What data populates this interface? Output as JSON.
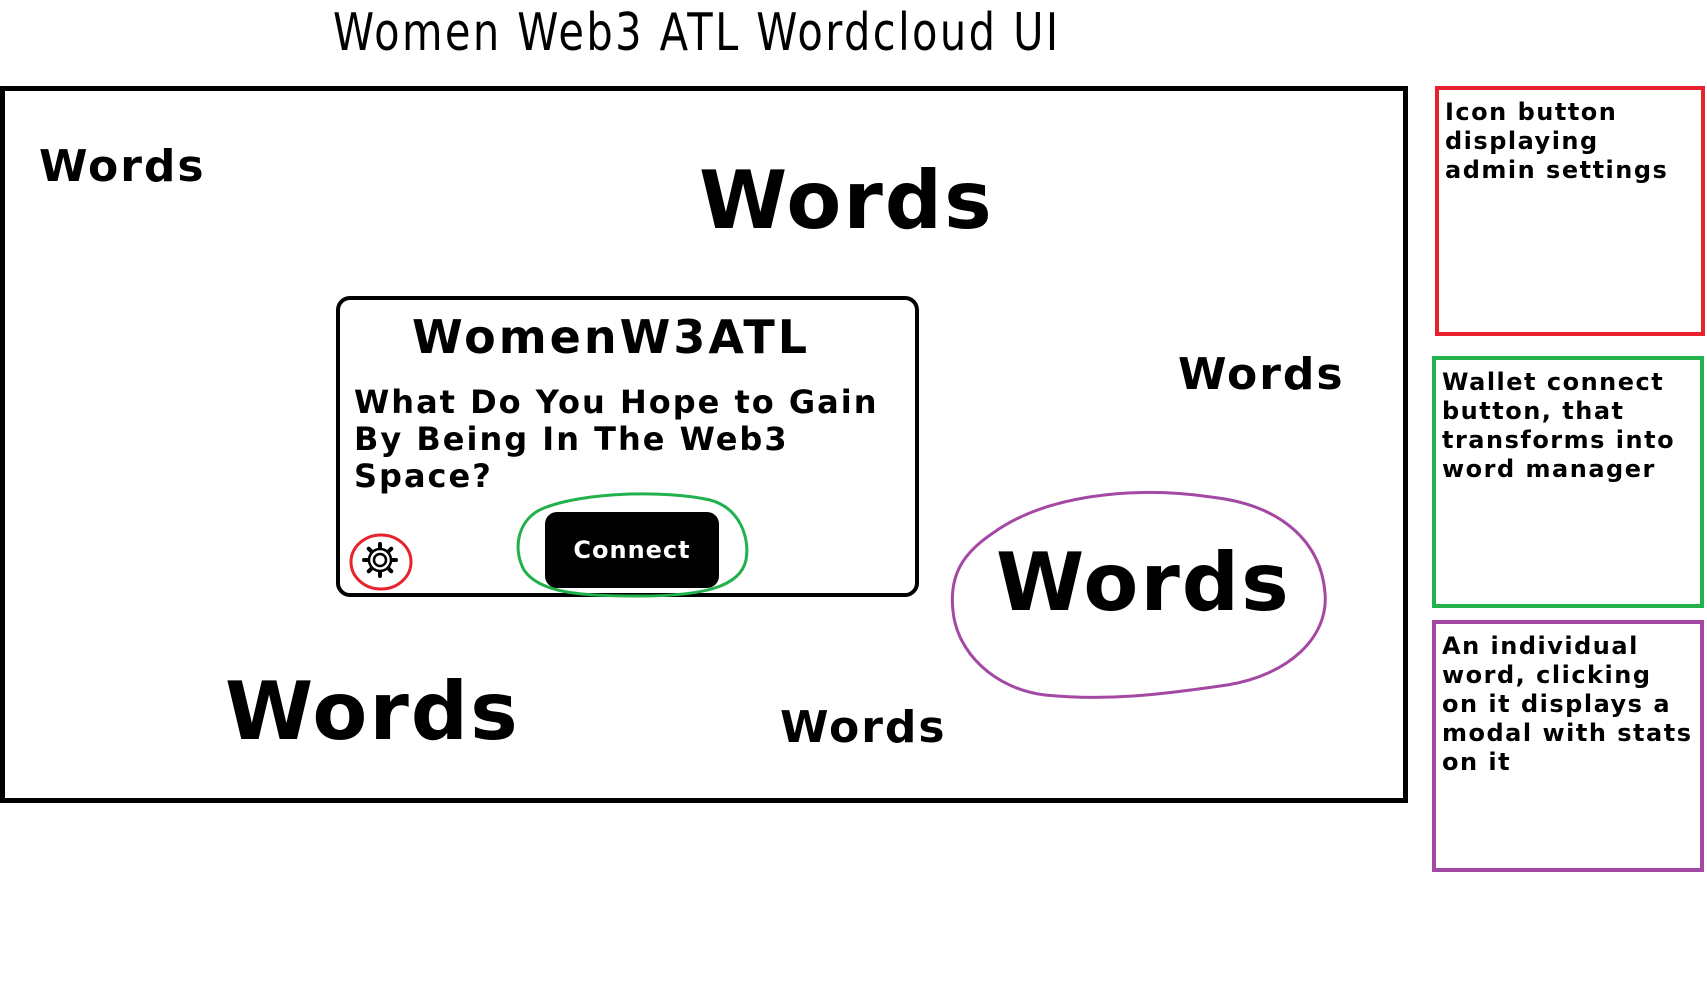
{
  "page": {
    "title": "Women Web3 ATL Wordcloud UI"
  },
  "wordcloud": {
    "words": [
      {
        "text": "Words"
      },
      {
        "text": "Words"
      },
      {
        "text": "Words"
      },
      {
        "text": "Words"
      },
      {
        "text": "Words"
      },
      {
        "text": "Words"
      }
    ]
  },
  "modal": {
    "title": "WomenW3ATL",
    "question": "What Do You Hope to Gain By Being In The Web3 Space?",
    "connect_label": "Connect",
    "settings_icon": "gear-icon"
  },
  "annotations": [
    {
      "text": "Icon button displaying admin settings",
      "color": "#e8222c"
    },
    {
      "text": "Wallet connect button, that transforms into word manager",
      "color": "#22b14c"
    },
    {
      "text": "An individual word, clicking on it displays a modal with stats on it",
      "color": "#a349a4"
    }
  ],
  "colors": {
    "settings_highlight": "#e8222c",
    "connect_highlight": "#22b14c",
    "word_highlight": "#a349a4"
  }
}
